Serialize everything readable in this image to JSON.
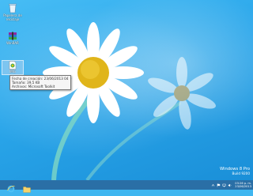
{
  "desktop": {
    "icons": [
      {
        "label": "Papelera de reciclaje",
        "icon": "recycle-bin-icon"
      },
      {
        "label": "WinRAR",
        "icon": "winrar-icon"
      },
      {
        "label": "IMG",
        "icon": "image-file-icon"
      }
    ]
  },
  "tooltip": {
    "line1": "Fecha de creación: 23/06/2013 04:29 p. m.",
    "line2": "Tamaño: 39,5 KB",
    "line3": "Archivos: Microsoft Toolkit"
  },
  "watermark": {
    "line1": "Windows 8 Pro",
    "line2": "Build 9200"
  },
  "taskbar": {
    "pinned": [
      {
        "name": "internet-explorer",
        "icon": "internet-explorer-icon"
      },
      {
        "name": "file-explorer",
        "icon": "folder-icon"
      }
    ],
    "clock_time": "03:26 p. m.",
    "clock_date": "23/06/2013"
  },
  "colors": {
    "wallpaper_blue": "#2aa6ea",
    "taskbar": "#2a6fa6",
    "daisy_center": "#e0b51a"
  }
}
